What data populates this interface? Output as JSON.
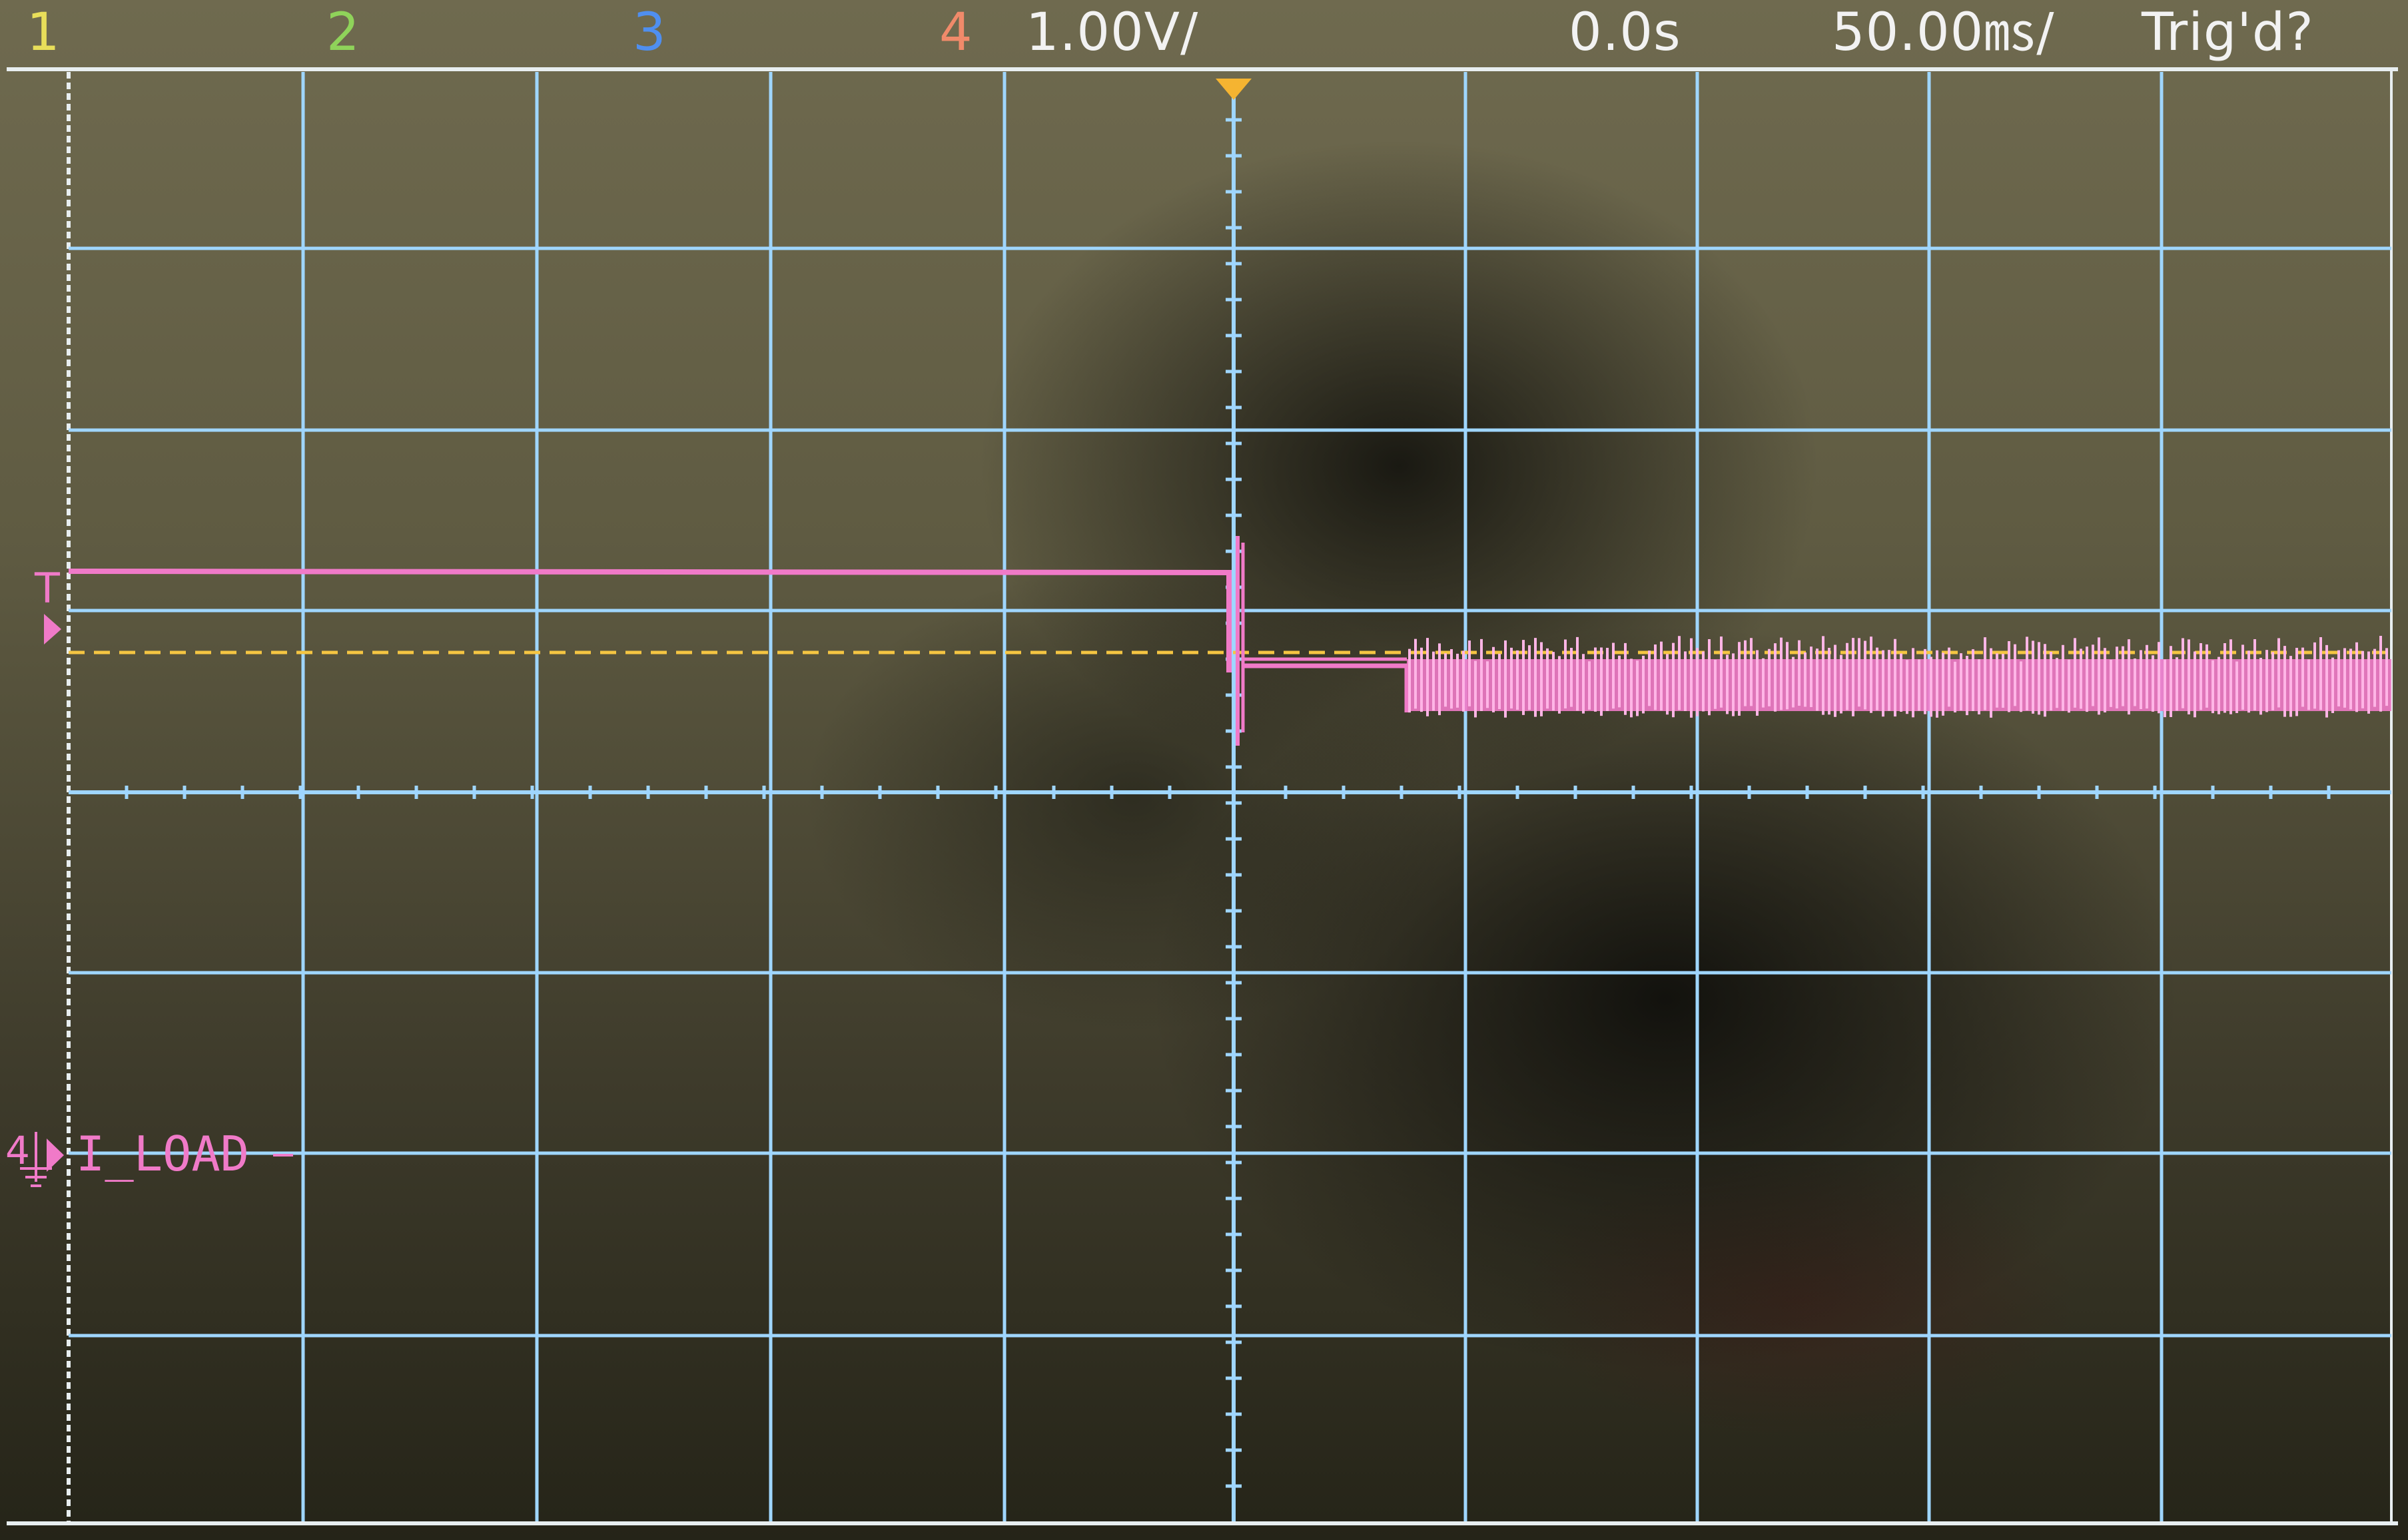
{
  "header": {
    "channels": [
      {
        "label": "1",
        "color": "#e8de5a"
      },
      {
        "label": "2",
        "color": "#8fd35a"
      },
      {
        "label": "3",
        "color": "#4f8ff0"
      },
      {
        "label": "4",
        "color": "#f08a6a"
      }
    ],
    "volts_per_div": "1.00V/",
    "time_offset": "0.0s",
    "time_per_div": "50.00㎳/",
    "trigger_status": "Trig'd?"
  },
  "trace": {
    "channel_marker": "4",
    "label": "I_LOAD",
    "color": "#f07ac8"
  },
  "trigger_marker": {
    "label": "T",
    "color": "#f07ac8"
  },
  "colors": {
    "grid": "#9fd6ff",
    "trigger_level": "#f5c542",
    "frame": "#e8eef0"
  }
}
